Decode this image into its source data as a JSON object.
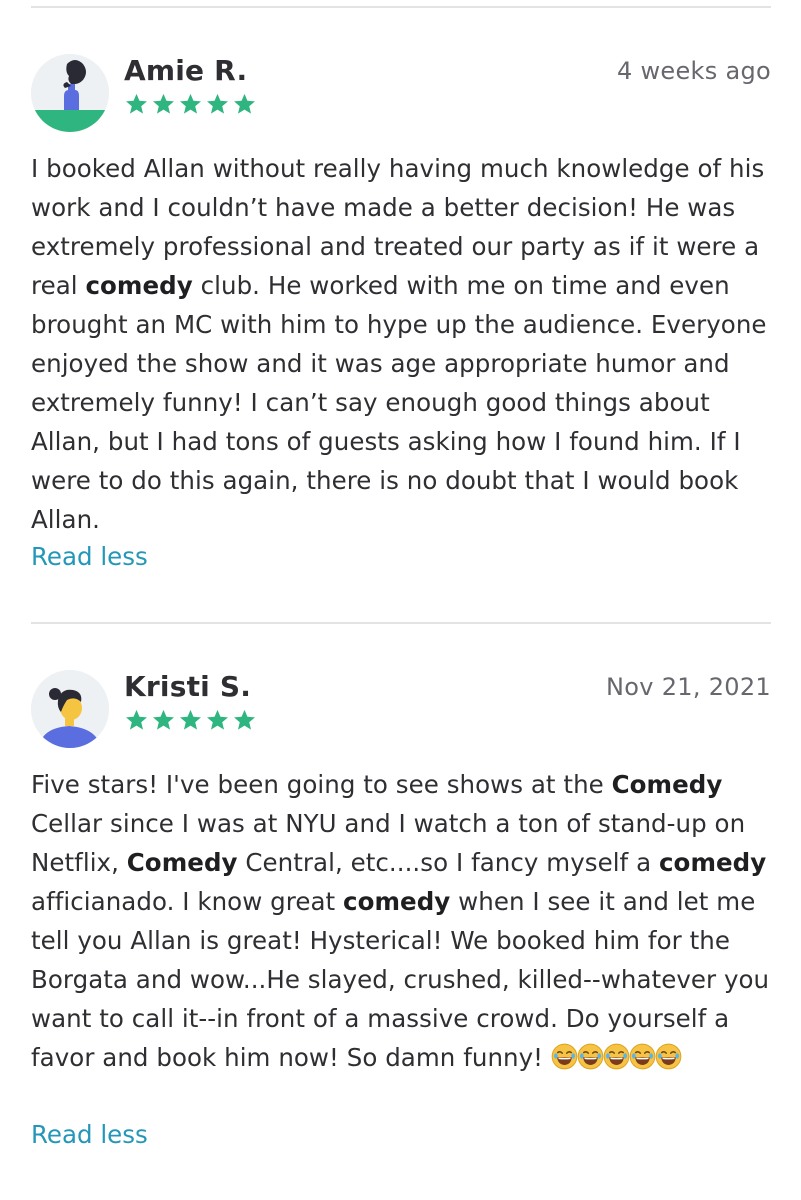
{
  "reviews": [
    {
      "name": "Amie R.",
      "date": "4 weeks ago",
      "rating": 5,
      "text_parts": [
        "I booked Allan without really having much knowledge of his work and I couldn’t have made a better decision! He was extremely professional and treated our party as if it were a real ",
        "comedy",
        " club. He worked with me on time and even brought an MC with him to hype up the audience. Everyone enjoyed the show and it was age appropriate humor and extremely funny! I can’t say enough good things about Allan, but I had tons of guests asking how I found him. If I were to do this again, there is no doubt that I would book Allan."
      ],
      "toggle_label": "Read less"
    },
    {
      "name": "Kristi S.",
      "date": "Nov 21, 2021",
      "rating": 5,
      "text_parts": [
        "Five stars! I've been going to see shows at the ",
        "Comedy",
        " Cellar since I was at NYU and I watch a ton of stand-up on Netflix, ",
        "Comedy",
        " Central, etc....so I fancy myself a ",
        "comedy",
        " afficianado. I know great ",
        "comedy",
        " when I see it and let me tell you Allan is great! Hysterical! We booked him for the Borgata and wow...He slayed, crushed, killed--whatever you want to call it--in front of a massive crowd. Do yourself a favor and book him now! So damn funny! "
      ],
      "emoji_count": 5,
      "toggle_label": "Read less"
    }
  ],
  "icons": {
    "star": "star-icon",
    "emoji": "laughing-tears-emoji-icon"
  },
  "colors": {
    "star": "#2fb57f",
    "link": "#2497b8",
    "avatar1_ground": "#2fb57f",
    "avatar2_shirt": "#5a6ee0",
    "avatar2_skin": "#f5c542",
    "emoji_face": "#f6c344"
  }
}
